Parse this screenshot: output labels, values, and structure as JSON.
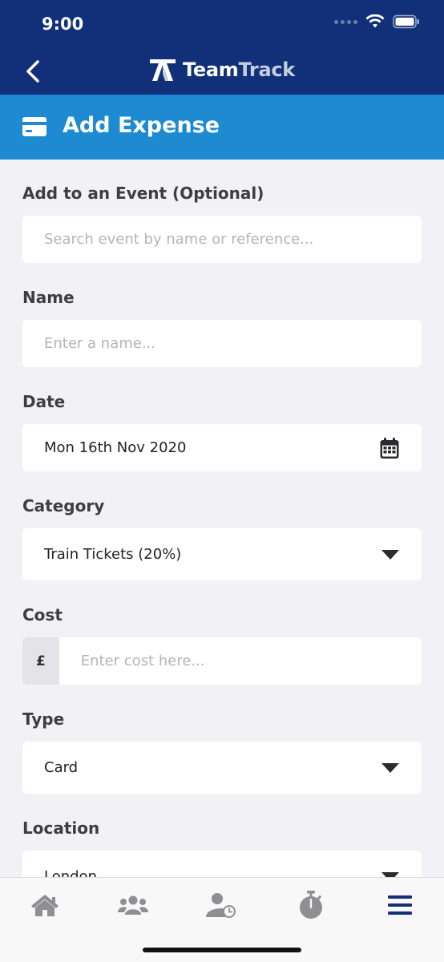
{
  "status_bar": {
    "time": "9:00"
  },
  "nav": {
    "brand_team": "Team",
    "brand_track": "Track"
  },
  "header": {
    "title": "Add Expense"
  },
  "form": {
    "event": {
      "label": "Add to an Event (Optional)",
      "placeholder": "Search event by name or reference..."
    },
    "name": {
      "label": "Name",
      "placeholder": "Enter a name..."
    },
    "date": {
      "label": "Date",
      "value": "Mon 16th Nov 2020"
    },
    "category": {
      "label": "Category",
      "value": "Train Tickets (20%)"
    },
    "cost": {
      "label": "Cost",
      "currency": "£",
      "placeholder": "Enter cost here..."
    },
    "type": {
      "label": "Type",
      "value": "Card"
    },
    "location": {
      "label": "Location",
      "value": "London"
    }
  },
  "tabs": [
    {
      "name": "home",
      "icon": "home-icon"
    },
    {
      "name": "team",
      "icon": "people-icon"
    },
    {
      "name": "timesheets",
      "icon": "person-clock-icon"
    },
    {
      "name": "timer",
      "icon": "stopwatch-icon"
    },
    {
      "name": "menu",
      "icon": "hamburger-menu-icon"
    }
  ],
  "colors": {
    "nav": "#12307a",
    "header": "#1d8ad1",
    "background": "#f2f2f6",
    "tab_inactive": "#8e8e93",
    "tab_active": "#12307a"
  }
}
